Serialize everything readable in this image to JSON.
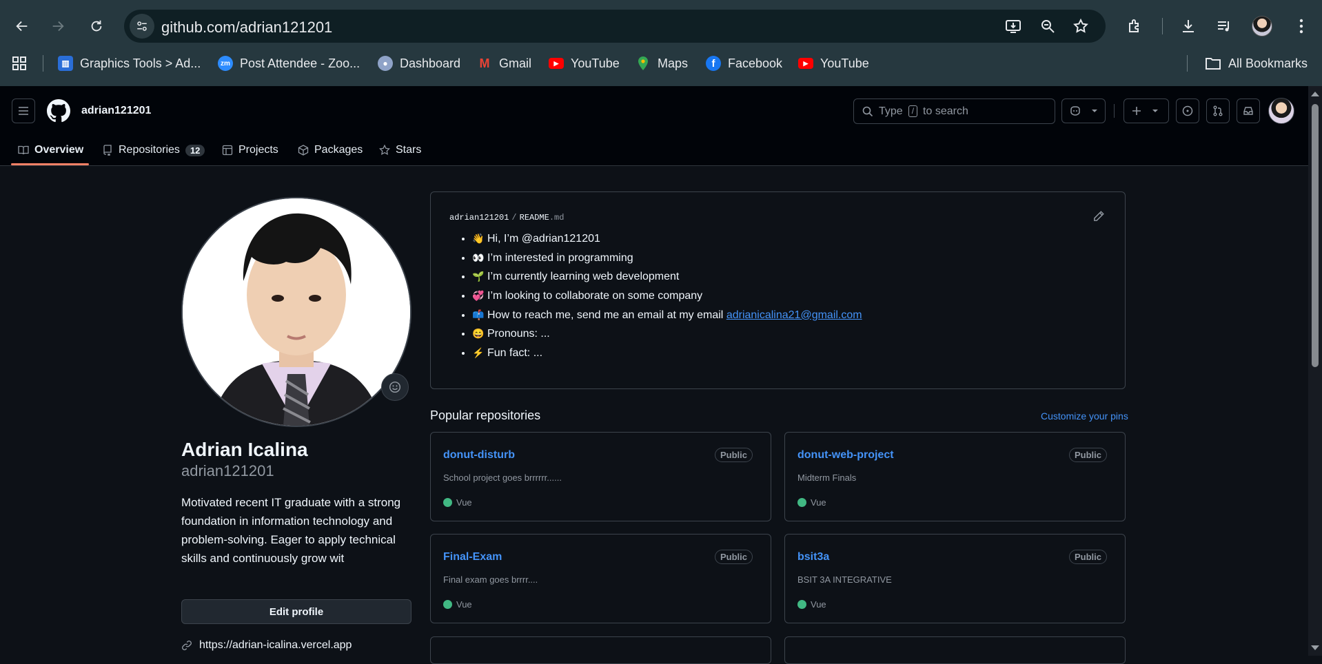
{
  "browser": {
    "url": "github.com/adrian121201",
    "bookmarks": [
      {
        "label": "Graphics Tools > Ad...",
        "icon": "graphics-tools-icon",
        "color": "#2a6ed8"
      },
      {
        "label": "Post Attendee - Zoo...",
        "icon": "zoom-icon",
        "color": "#2d8cff"
      },
      {
        "label": "Dashboard",
        "icon": "dashboard-icon",
        "color": "#8fa3c8"
      },
      {
        "label": "Gmail",
        "icon": "gmail-icon",
        "color": "#ea4335"
      },
      {
        "label": "YouTube",
        "icon": "youtube-icon",
        "color": "#ff0000"
      },
      {
        "label": "Maps",
        "icon": "maps-icon",
        "color": "#34a853"
      },
      {
        "label": "Facebook",
        "icon": "facebook-icon",
        "color": "#1877f2"
      },
      {
        "label": "YouTube",
        "icon": "youtube-icon",
        "color": "#ff0000"
      }
    ],
    "all_bookmarks": "All Bookmarks"
  },
  "header": {
    "username": "adrian121201",
    "search_prefix": "Type",
    "search_key": "/",
    "search_suffix": "to search"
  },
  "tabs": [
    {
      "label": "Overview",
      "icon": "book-icon"
    },
    {
      "label": "Repositories",
      "icon": "repo-icon",
      "count": "12"
    },
    {
      "label": "Projects",
      "icon": "table-icon"
    },
    {
      "label": "Packages",
      "icon": "package-icon"
    },
    {
      "label": "Stars",
      "icon": "star-icon"
    }
  ],
  "profile": {
    "name": "Adrian Icalina",
    "login": "adrian121201",
    "bio": "Motivated recent IT graduate with a strong foundation in information technology and problem-solving. Eager to apply technical skills and continuously grow wit",
    "edit_label": "Edit profile",
    "website": "https://adrian-icalina.vercel.app"
  },
  "readme": {
    "owner": "adrian121201",
    "file": "README",
    "ext": ".md",
    "items": [
      {
        "emoji": "👋",
        "text": "Hi, I’m @adrian121201"
      },
      {
        "emoji": "👀",
        "text": "I’m interested in programming"
      },
      {
        "emoji": "🌱",
        "text": "I’m currently learning web development"
      },
      {
        "emoji": "💞️",
        "text": "I’m looking to collaborate on some company"
      },
      {
        "emoji": "📫",
        "text": "How to reach me, send me an email at my email",
        "link": "adrianicalina21@gmail.com"
      },
      {
        "emoji": "😄",
        "text": "Pronouns: ..."
      },
      {
        "emoji": "⚡",
        "text": "Fun fact: ..."
      }
    ]
  },
  "popular": {
    "title": "Popular repositories",
    "customize": "Customize your pins",
    "repos": [
      {
        "name": "donut-disturb",
        "visibility": "Public",
        "description": "School project goes brrrrrr......",
        "language": "Vue",
        "lang_color": "#41b883"
      },
      {
        "name": "donut-web-project",
        "visibility": "Public",
        "description": "Midterm Finals",
        "language": "Vue",
        "lang_color": "#41b883"
      },
      {
        "name": "Final-Exam",
        "visibility": "Public",
        "description": "Final exam goes brrrr....",
        "language": "Vue",
        "lang_color": "#41b883"
      },
      {
        "name": "bsit3a",
        "visibility": "Public",
        "description": "BSIT 3A INTEGRATIVE",
        "language": "Vue",
        "lang_color": "#41b883"
      }
    ]
  }
}
